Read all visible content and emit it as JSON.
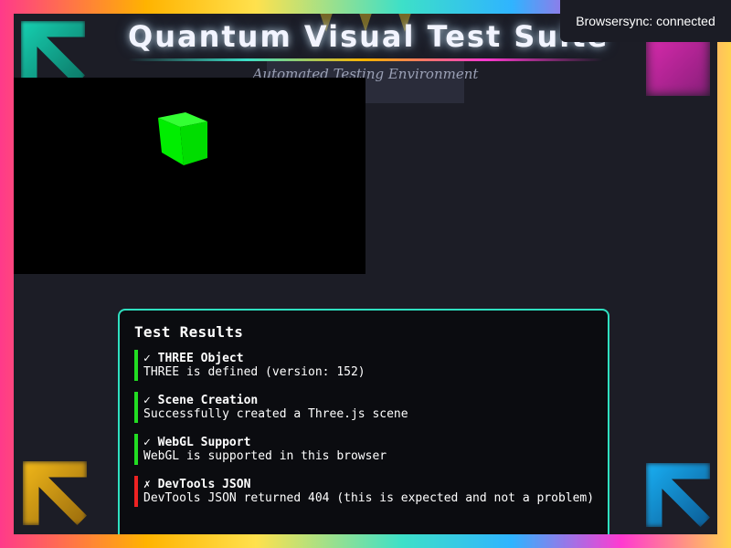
{
  "page": {
    "title": "Quantum Visual Test Suite",
    "subtitle": "Automated Testing Environment"
  },
  "results": {
    "heading": "Test Results",
    "items": [
      {
        "name": "✓ THREE Object",
        "message": "THREE is defined (version: 152)",
        "status": "pass"
      },
      {
        "name": "✓ Scene Creation",
        "message": "Successfully created a Three.js scene",
        "status": "pass"
      },
      {
        "name": "✓ WebGL Support",
        "message": "WebGL is supported in this browser",
        "status": "pass"
      },
      {
        "name": "✗ DevTools JSON",
        "message": "DevTools JSON returned 404 (this is expected and not a problem)",
        "status": "fail"
      }
    ]
  },
  "browsersync": {
    "status": "Browsersync: connected"
  },
  "colors": {
    "accent": "#2fe0c0",
    "pass": "#22dd22",
    "fail": "#ee2222",
    "cube": "#00ff00"
  },
  "icons": [
    "check-icon",
    "cross-icon"
  ]
}
